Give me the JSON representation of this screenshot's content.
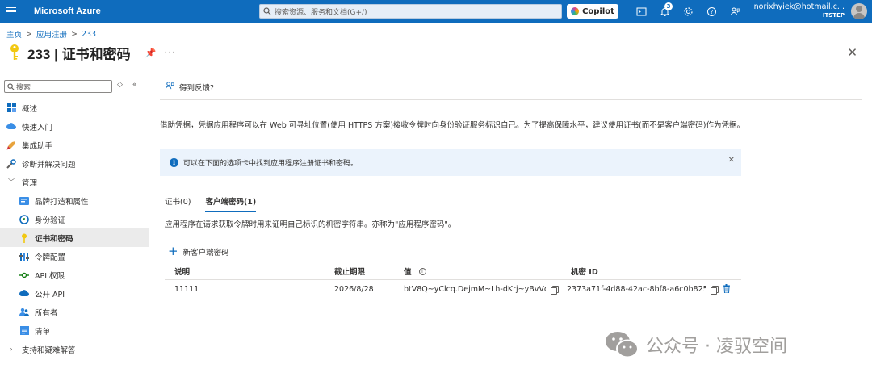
{
  "topbar": {
    "brand": "Microsoft Azure",
    "search_placeholder": "搜索资源、服务和文档(G+/)",
    "copilot_label": "Copilot",
    "notification_count": "3",
    "account_email": "norixhyiek@hotmail.c...",
    "account_tenant": "ITSTEP"
  },
  "breadcrumb": [
    "主页",
    "应用注册",
    "233"
  ],
  "page": {
    "title": "233 | 证书和密码"
  },
  "sidebar": {
    "search_placeholder": "搜索",
    "items": [
      {
        "label": "概述",
        "icon": "grid-icon"
      },
      {
        "label": "快速入门",
        "icon": "cloud-icon"
      },
      {
        "label": "集成助手",
        "icon": "rocket-icon"
      },
      {
        "label": "诊断并解决问题",
        "icon": "wrench-icon"
      },
      {
        "label": "管理",
        "icon": "chevron-down-icon"
      },
      {
        "label": "品牌打造和属性",
        "icon": "branding-icon"
      },
      {
        "label": "身份验证",
        "icon": "auth-icon"
      },
      {
        "label": "证书和密码",
        "icon": "key-icon"
      },
      {
        "label": "令牌配置",
        "icon": "token-icon"
      },
      {
        "label": "API 权限",
        "icon": "api-icon"
      },
      {
        "label": "公开 API",
        "icon": "cloud-api-icon"
      },
      {
        "label": "所有者",
        "icon": "owners-icon"
      },
      {
        "label": "清单",
        "icon": "manifest-icon"
      },
      {
        "label": "支持和疑难解答",
        "icon": "chevron-right-icon"
      }
    ]
  },
  "main": {
    "feedback_label": "得到反馈?",
    "intro": "借助凭据，凭据应用程序可以在 Web 可寻址位置(使用 HTTPS 方案)接收令牌时向身份验证服务标识自己。为了提高保障水平，建议使用证书(而不是客户端密码)作为凭据。",
    "info_text": "可以在下面的选项卡中找到应用程序注册证书和密码。",
    "tabs": [
      {
        "label": "证书(0)",
        "active": false
      },
      {
        "label": "客户端密码(1)",
        "active": true
      }
    ],
    "tab_description": "应用程序在请求获取令牌时用来证明自己标识的机密字符串。亦称为\"应用程序密码\"。",
    "add_label": "新客户端密码",
    "table": {
      "headers": [
        "说明",
        "截止期限",
        "值",
        "机密 ID"
      ],
      "rows": [
        {
          "description": "11111",
          "expires": "2026/8/28",
          "value": "btV8Q~yClcq.DejmM~Lh-dKrj~yBvVc...",
          "secret_id": "2373a71f-4d88-42ac-8bf8-a6c0b825..."
        }
      ]
    }
  },
  "watermark": {
    "text": "公众号 · 凌驭空间"
  },
  "colors": {
    "accent": "#0f6cbd",
    "info_bg": "#ebf3fc",
    "active_nav": "#ebebeb"
  }
}
